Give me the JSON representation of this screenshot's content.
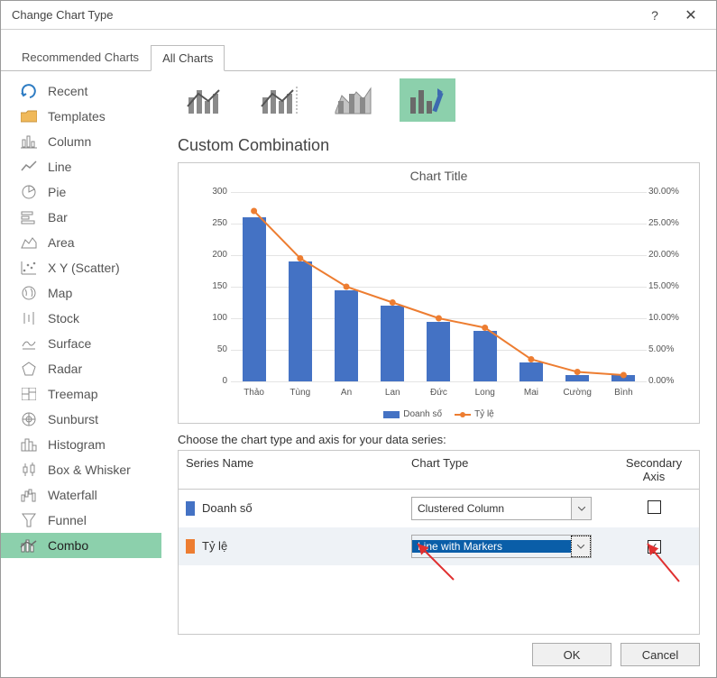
{
  "title": "Change Chart Type",
  "tabs": {
    "recommended": "Recommended Charts",
    "all": "All Charts"
  },
  "sidebar": {
    "items": [
      {
        "label": "Recent"
      },
      {
        "label": "Templates"
      },
      {
        "label": "Column"
      },
      {
        "label": "Line"
      },
      {
        "label": "Pie"
      },
      {
        "label": "Bar"
      },
      {
        "label": "Area"
      },
      {
        "label": "X Y (Scatter)"
      },
      {
        "label": "Map"
      },
      {
        "label": "Stock"
      },
      {
        "label": "Surface"
      },
      {
        "label": "Radar"
      },
      {
        "label": "Treemap"
      },
      {
        "label": "Sunburst"
      },
      {
        "label": "Histogram"
      },
      {
        "label": "Box & Whisker"
      },
      {
        "label": "Waterfall"
      },
      {
        "label": "Funnel"
      },
      {
        "label": "Combo"
      }
    ]
  },
  "main": {
    "heading": "Custom Combination",
    "preview_title": "Chart Title",
    "choose_label": "Choose the chart type and axis for your data series:",
    "table": {
      "h_name": "Series Name",
      "h_type": "Chart Type",
      "h_sec": "Secondary Axis",
      "rows": [
        {
          "name": "Doanh số",
          "type": "Clustered Column",
          "secondary": false
        },
        {
          "name": "Tỷ lệ",
          "type": "Line with Markers",
          "secondary": true
        }
      ]
    }
  },
  "footer": {
    "ok": "OK",
    "cancel": "Cancel"
  },
  "chart_data": {
    "type": "bar",
    "title": "Chart Title",
    "categories": [
      "Thảo",
      "Tùng",
      "An",
      "Lan",
      "Đức",
      "Long",
      "Mai",
      "Cường",
      "Bình"
    ],
    "series": [
      {
        "name": "Doanh số",
        "type": "bar",
        "axis": "primary",
        "values": [
          260,
          190,
          145,
          120,
          95,
          80,
          30,
          10,
          10
        ]
      },
      {
        "name": "Tỷ lệ",
        "type": "line",
        "axis": "secondary",
        "values": [
          0.27,
          0.195,
          0.15,
          0.125,
          0.1,
          0.085,
          0.035,
          0.015,
          0.01
        ]
      }
    ],
    "ylabel": "",
    "ylim": [
      0,
      300
    ],
    "y2label": "",
    "y2lim": [
      0,
      0.3
    ],
    "y_ticks": [
      0,
      50,
      100,
      150,
      200,
      250,
      300
    ],
    "y2_ticks": [
      "0.00%",
      "5.00%",
      "10.00%",
      "15.00%",
      "20.00%",
      "25.00%",
      "30.00%"
    ],
    "legend": [
      "Doanh số",
      "Tỷ lệ"
    ]
  }
}
